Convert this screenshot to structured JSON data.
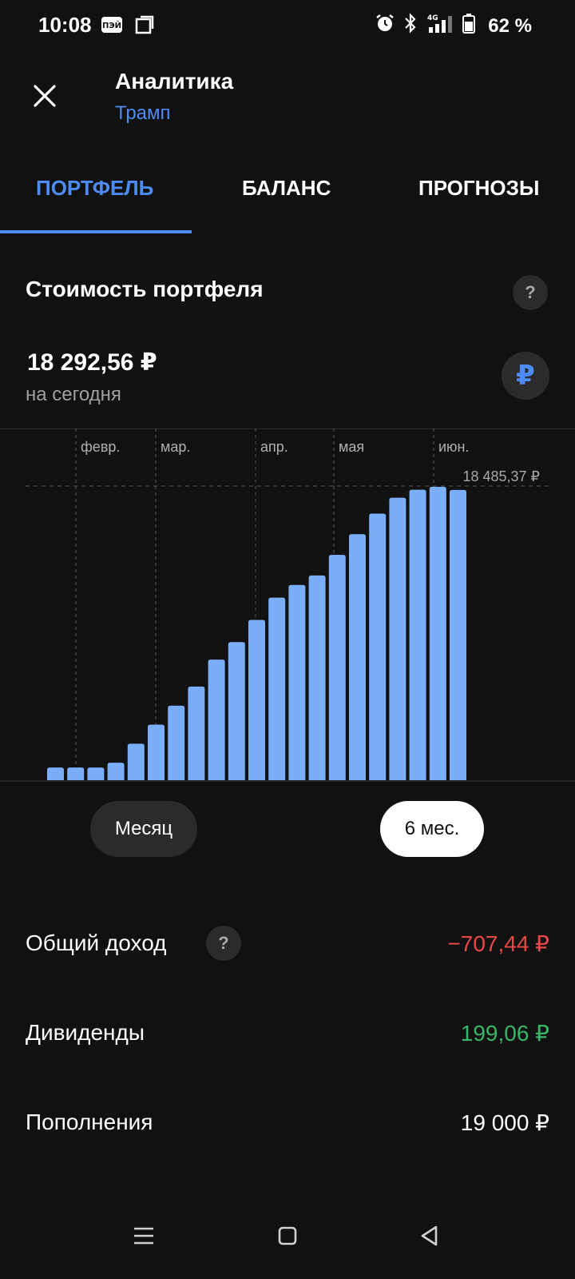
{
  "status_bar": {
    "time": "10:08",
    "battery": "62 %",
    "network": "4G"
  },
  "header": {
    "title": "Аналитика",
    "subtitle": "Трамп"
  },
  "tabs": [
    {
      "label": "ПОРТФЕЛЬ",
      "active": true
    },
    {
      "label": "БАЛАНС",
      "active": false
    },
    {
      "label": "ПРОГНОЗЫ",
      "active": false
    }
  ],
  "portfolio": {
    "title": "Стоимость портфеля",
    "value": "18 292,56  ₽",
    "sub": "на сегодня",
    "currency_symbol": "₽",
    "help_symbol": "?"
  },
  "chart_data": {
    "type": "bar",
    "months": [
      {
        "label": "февр."
      },
      {
        "label": "мар."
      },
      {
        "label": "апр."
      },
      {
        "label": "мая"
      },
      {
        "label": "июн."
      }
    ],
    "max_label": "18 485,37 ₽",
    "ylim": [
      0,
      18485.37
    ],
    "values": [
      800,
      800,
      800,
      1100,
      2300,
      3500,
      4700,
      5900,
      7600,
      8700,
      10100,
      11500,
      12300,
      12900,
      14200,
      15500,
      16800,
      17800,
      18300,
      18485.37,
      18292.56
    ],
    "bar_color": "#7aaef8"
  },
  "periods": [
    {
      "label": "Месяц",
      "selected": false
    },
    {
      "label": "6 мес.",
      "selected": true
    }
  ],
  "stats": [
    {
      "label": "Общий доход",
      "value": "−707,44 ₽",
      "tone": "neg",
      "help": true
    },
    {
      "label": "Дивиденды",
      "value": "199,06 ₽",
      "tone": "pos",
      "help": false
    },
    {
      "label": "Пополнения",
      "value": "19 000 ₽",
      "tone": "neutral",
      "help": false
    }
  ],
  "colors": {
    "accent": "#4d8cf5",
    "negative": "#e84848",
    "positive": "#38b56a",
    "background": "#111111"
  }
}
